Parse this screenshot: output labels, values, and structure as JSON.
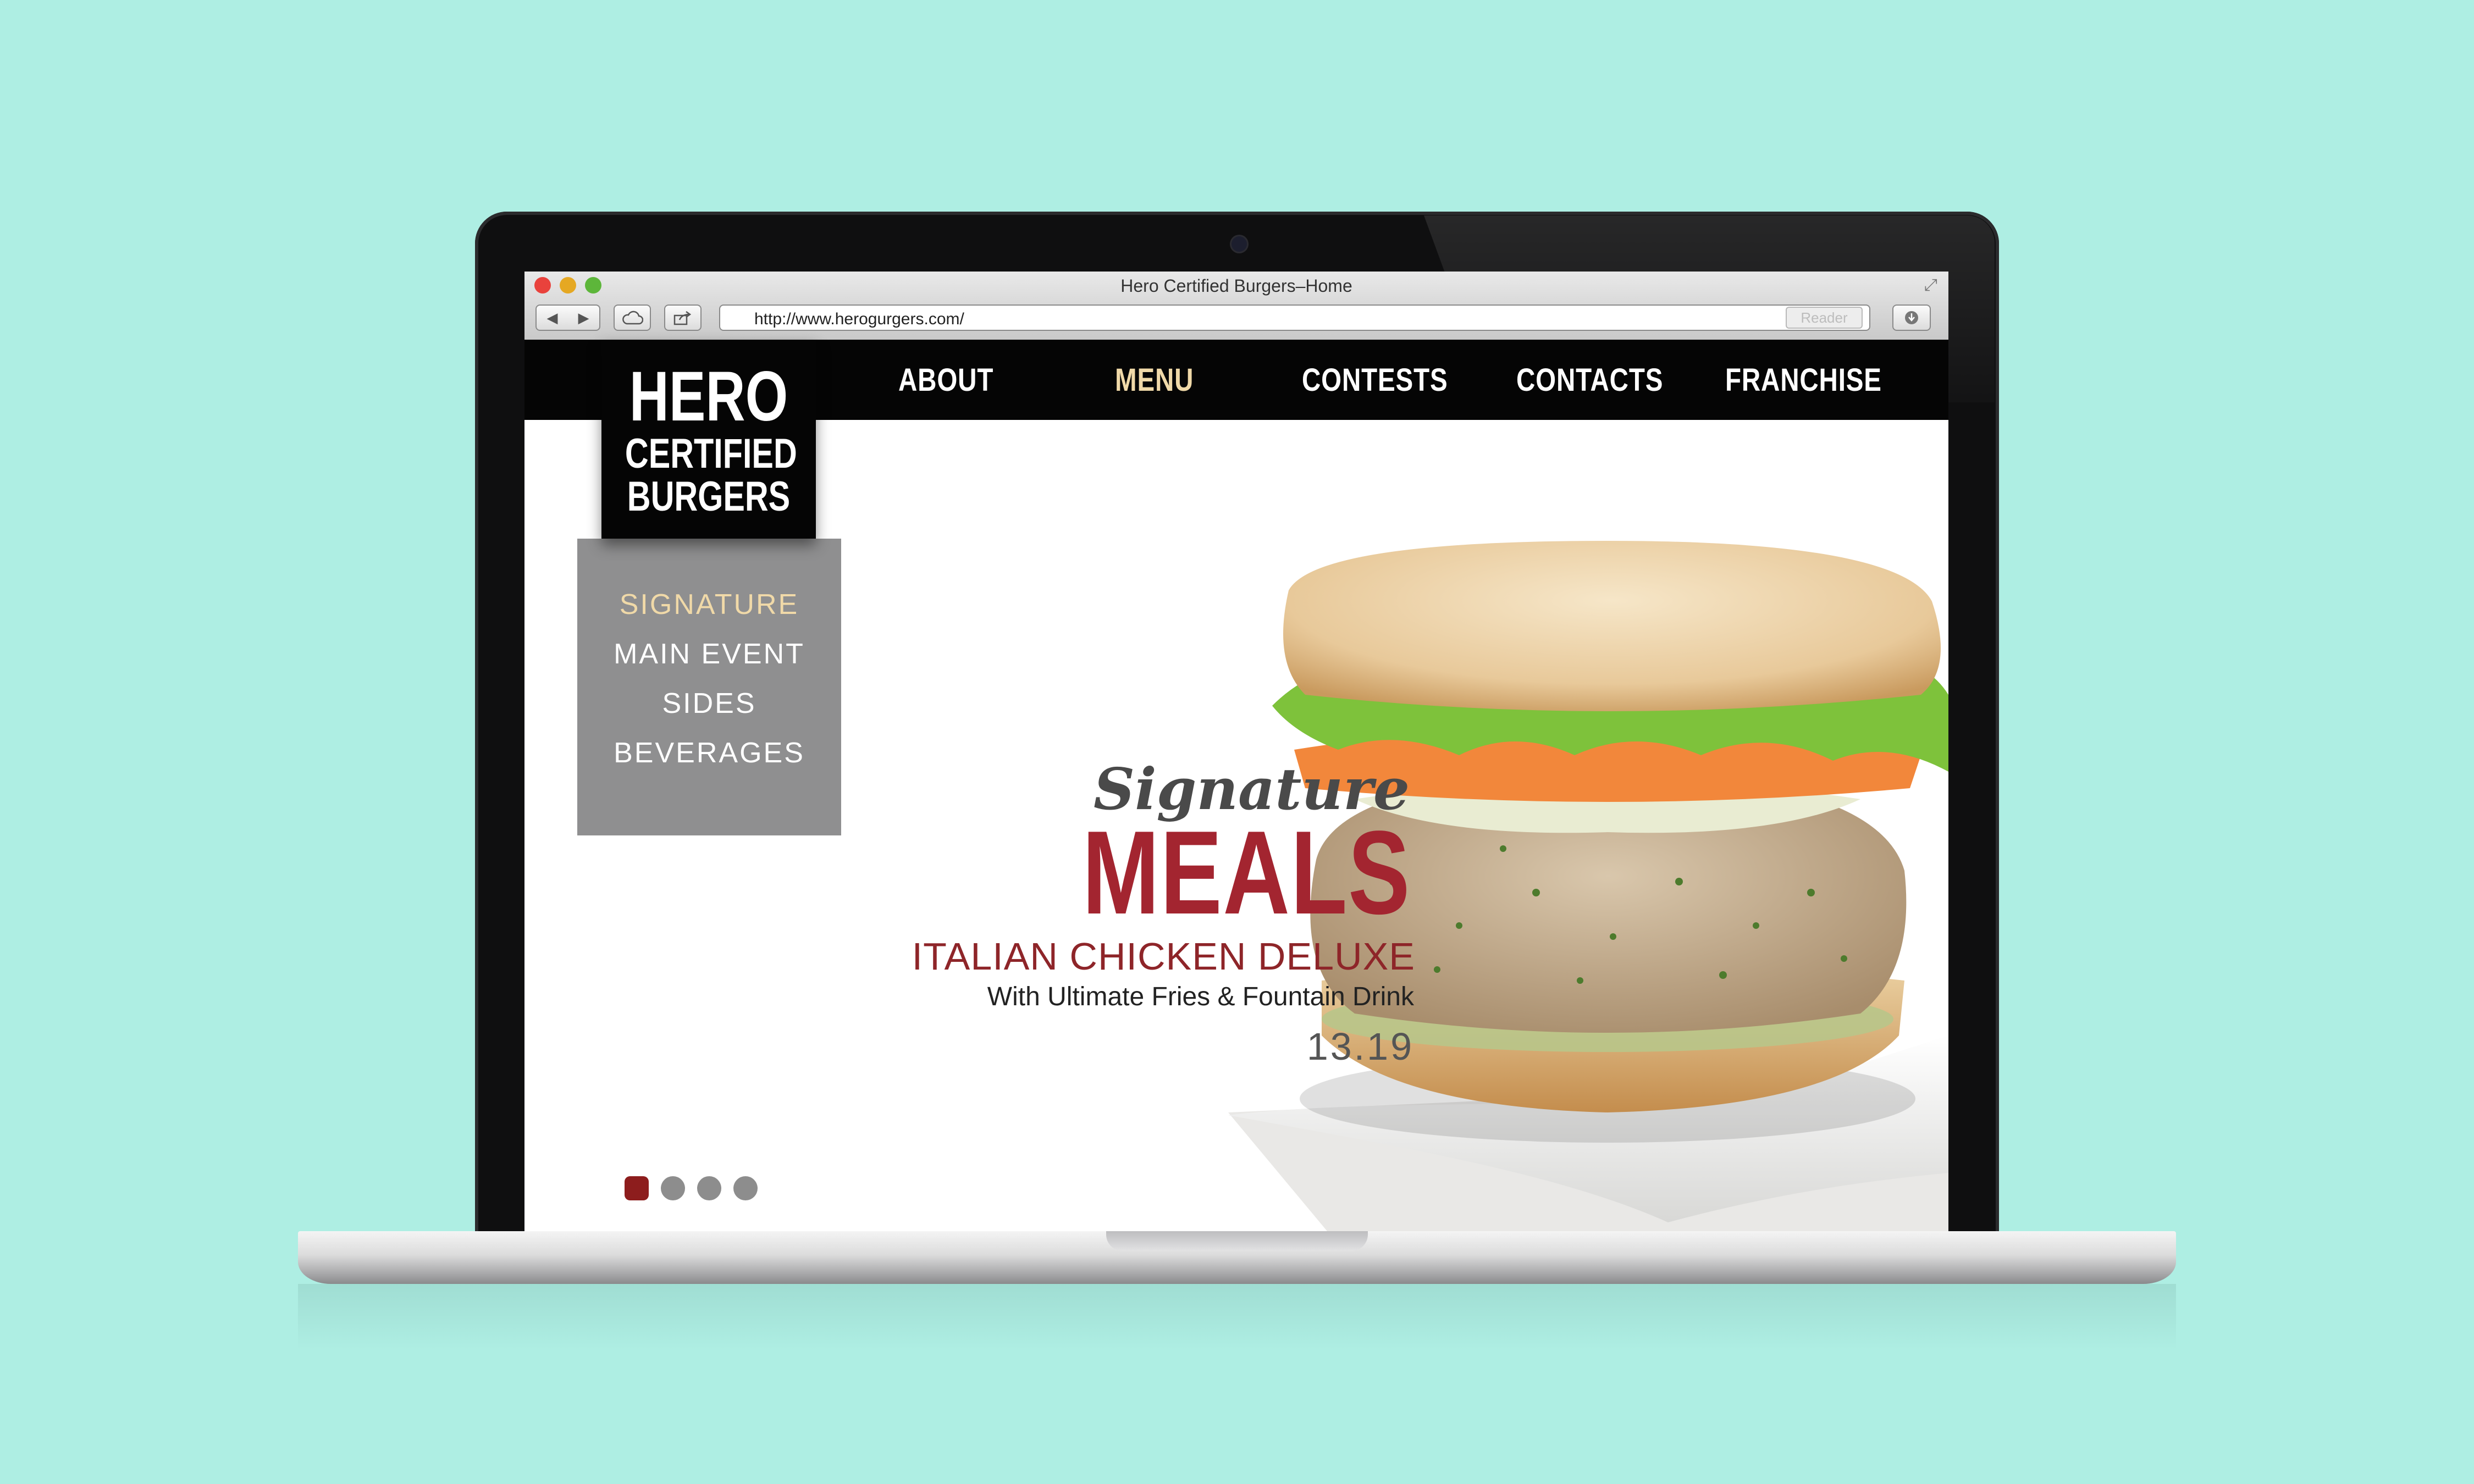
{
  "browser": {
    "window_title": "Hero  Certified Burgers–Home",
    "url": "http://www.herogurgers.com/",
    "reader_label": "Reader",
    "icons": [
      "back-icon",
      "forward-icon",
      "icloud-icon",
      "share-icon",
      "reload-icon",
      "download-icon",
      "fullscreen-icon"
    ]
  },
  "site": {
    "logo": {
      "line1": "HERO",
      "line2": "CERTIFIED",
      "line3": "BURGERS"
    },
    "nav": [
      {
        "label": "ABOUT",
        "active": false
      },
      {
        "label": "MENU",
        "active": true
      },
      {
        "label": "CONTESTS",
        "active": false
      },
      {
        "label": "CONTACTS",
        "active": false
      },
      {
        "label": "FRANCHISE",
        "active": false
      }
    ],
    "submenu": [
      {
        "label": "SIGNATURE",
        "active": true
      },
      {
        "label": "MAIN EVENT",
        "active": false
      },
      {
        "label": "SIDES",
        "active": false
      },
      {
        "label": "BEVERAGES",
        "active": false
      }
    ],
    "promo": {
      "script_title": "Signature",
      "title": "MEALS",
      "item": "ITALIAN CHICKEN DELUXE",
      "description": "With Ultimate Fries & Fountain Drink",
      "price": "13.19"
    },
    "slider": {
      "count": 4,
      "active_index": 0
    }
  },
  "colors": {
    "background": "#aeeee3",
    "nav_active": "#f0d9a8",
    "accent_red": "#a32530",
    "submenu_bg": "#8f8f90",
    "dot_active": "#8d1d1d"
  }
}
